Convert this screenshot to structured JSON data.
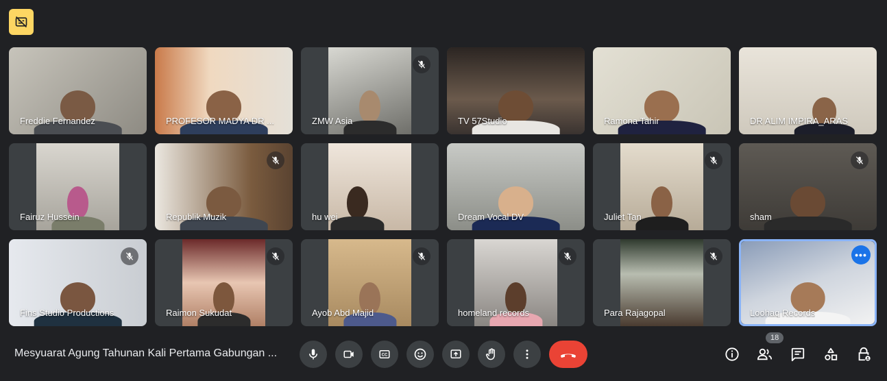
{
  "top": {
    "captions_badge_icon": "captions-off-icon"
  },
  "participants": [
    {
      "name": "Freddie Fernandez",
      "muted": false
    },
    {
      "name": "PROFESOR MADYA DR ...",
      "muted": false
    },
    {
      "name": "ZMW Asia",
      "muted": true
    },
    {
      "name": "TV 57Studio",
      "muted": false
    },
    {
      "name": "Ramona Tahir",
      "muted": false
    },
    {
      "name": "DR ALIM IMPIRA_ARAS",
      "muted": false
    },
    {
      "name": "Fairuz Hussein",
      "muted": false
    },
    {
      "name": "Republik Muzik",
      "muted": true
    },
    {
      "name": "hu wei",
      "muted": false
    },
    {
      "name": "Dream Vocal DV",
      "muted": false
    },
    {
      "name": "Juliet Tan",
      "muted": true
    },
    {
      "name": "sham",
      "muted": true
    },
    {
      "name": "Fins Studio Productions",
      "muted": true
    },
    {
      "name": "Raimon Sukudat",
      "muted": true
    },
    {
      "name": "Ayob Abd Majid",
      "muted": true
    },
    {
      "name": "homeland records",
      "muted": true
    },
    {
      "name": "Para Rajagopal",
      "muted": true
    },
    {
      "name": "Loohaq Records",
      "muted": false,
      "pinned": true
    }
  ],
  "meeting": {
    "title": "Mesyuarat Agung Tahunan Kali Pertama Gabungan ...",
    "participant_count": "18"
  },
  "colors": {
    "accent": "#8ab4f8",
    "end_call": "#ea4335",
    "badge": "#fdd663",
    "background": "#202124"
  }
}
